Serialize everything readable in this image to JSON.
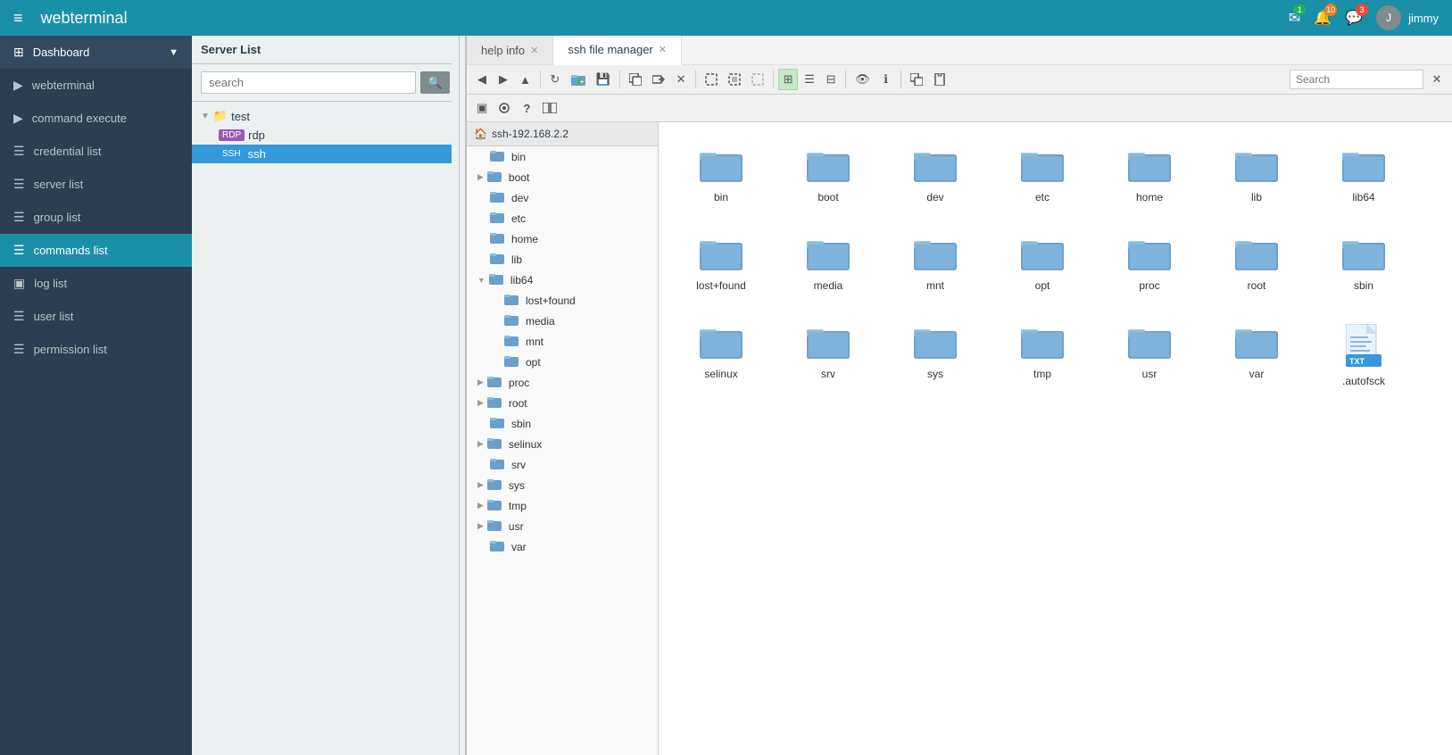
{
  "app": {
    "title_bold": "web",
    "title_light": "terminal"
  },
  "header": {
    "hamburger": "≡",
    "notifications": {
      "mail_count": "1",
      "bell_count": "10",
      "chat_count": "3"
    },
    "username": "jimmy"
  },
  "sidebar": {
    "items": [
      {
        "id": "dashboard",
        "label": "Dashboard",
        "icon": "⊞",
        "has_chevron": true
      },
      {
        "id": "webterminal",
        "label": "webterminal",
        "icon": "▶"
      },
      {
        "id": "command-execute",
        "label": "command execute",
        "icon": "▶"
      },
      {
        "id": "credential-list",
        "label": "credential list",
        "icon": "☰"
      },
      {
        "id": "server-list",
        "label": "server list",
        "icon": "☰"
      },
      {
        "id": "group-list",
        "label": "group list",
        "icon": "☰"
      },
      {
        "id": "commands-list",
        "label": "commands list",
        "icon": "☰"
      },
      {
        "id": "log-list",
        "label": "log list",
        "icon": "▣"
      },
      {
        "id": "user-list",
        "label": "user list",
        "icon": "☰"
      },
      {
        "id": "permission-list",
        "label": "permission list",
        "icon": "☰"
      }
    ]
  },
  "server_panel": {
    "header": "Server List",
    "search_placeholder": "search",
    "search_btn": "🔍",
    "tree": [
      {
        "type": "group",
        "label": "test",
        "indent": 0,
        "expanded": true
      },
      {
        "type": "server",
        "label": "rdp",
        "protocol": "rdp",
        "indent": 1
      },
      {
        "type": "server",
        "label": "ssh",
        "protocol": "ssh",
        "indent": 1,
        "selected": true
      }
    ]
  },
  "tabs": [
    {
      "id": "help-info",
      "label": "help info",
      "closable": true,
      "active": false
    },
    {
      "id": "ssh-file-manager",
      "label": "ssh file manager",
      "closable": true,
      "active": true
    }
  ],
  "toolbar": {
    "buttons_row1": [
      {
        "id": "back",
        "icon": "◀",
        "title": "Back"
      },
      {
        "id": "forward",
        "icon": "▶",
        "title": "Forward"
      },
      {
        "id": "up",
        "icon": "▲",
        "title": "Up"
      },
      {
        "id": "sep1",
        "icon": "",
        "type": "sep"
      },
      {
        "id": "reload",
        "icon": "↻",
        "title": "Reload"
      },
      {
        "id": "new-folder",
        "icon": "📁",
        "title": "New Folder"
      },
      {
        "id": "save",
        "icon": "💾",
        "title": "Save"
      },
      {
        "id": "sep2",
        "icon": "",
        "type": "sep"
      },
      {
        "id": "copy-to",
        "icon": "⬚",
        "title": "Copy To"
      },
      {
        "id": "move-to",
        "icon": "⬚",
        "title": "Move To"
      },
      {
        "id": "delete",
        "icon": "✕",
        "title": "Delete"
      },
      {
        "id": "sep3",
        "icon": "",
        "type": "sep"
      },
      {
        "id": "select-all",
        "icon": "⬚",
        "title": "Select All"
      },
      {
        "id": "invert",
        "icon": "⬚",
        "title": "Invert"
      },
      {
        "id": "select-none",
        "icon": "⬚",
        "title": "Select None"
      },
      {
        "id": "sep4",
        "icon": "",
        "type": "sep"
      },
      {
        "id": "icons-view",
        "icon": "⊞",
        "title": "Icons View",
        "active": true
      },
      {
        "id": "details-view",
        "icon": "☰",
        "title": "Details View"
      },
      {
        "id": "compact-view",
        "icon": "⊟",
        "title": "Compact View"
      },
      {
        "id": "sep5",
        "icon": "",
        "type": "sep"
      },
      {
        "id": "preview",
        "icon": "👁",
        "title": "Preview"
      },
      {
        "id": "info",
        "icon": "ℹ",
        "title": "Info"
      },
      {
        "id": "sep6",
        "icon": "",
        "type": "sep"
      },
      {
        "id": "copy",
        "icon": "⬚",
        "title": "Copy"
      },
      {
        "id": "paste",
        "icon": "⬚",
        "title": "Paste"
      }
    ],
    "search_placeholder": "Search",
    "close_icon": "✕",
    "buttons_row2": [
      {
        "id": "terminal",
        "icon": "▣",
        "title": "Terminal"
      },
      {
        "id": "view",
        "icon": "⊟",
        "title": "View"
      },
      {
        "id": "help",
        "icon": "?",
        "title": "Help"
      },
      {
        "id": "dual-pane",
        "icon": "⊞",
        "title": "Dual Pane"
      }
    ]
  },
  "file_tree": {
    "root": "ssh-192.168.2.2",
    "items": [
      {
        "label": "bin",
        "indent": 0,
        "has_children": false
      },
      {
        "label": "boot",
        "indent": 0,
        "has_children": true
      },
      {
        "label": "dev",
        "indent": 0,
        "has_children": false
      },
      {
        "label": "etc",
        "indent": 0,
        "has_children": false
      },
      {
        "label": "home",
        "indent": 0,
        "has_children": false
      },
      {
        "label": "lib",
        "indent": 0,
        "has_children": false
      },
      {
        "label": "lib64",
        "indent": 0,
        "has_children": true,
        "expanded": true
      },
      {
        "label": "lost+found",
        "indent": 1,
        "has_children": false
      },
      {
        "label": "media",
        "indent": 1,
        "has_children": false
      },
      {
        "label": "mnt",
        "indent": 1,
        "has_children": false
      },
      {
        "label": "opt",
        "indent": 1,
        "has_children": false
      },
      {
        "label": "proc",
        "indent": 0,
        "has_children": true
      },
      {
        "label": "root",
        "indent": 0,
        "has_children": true
      },
      {
        "label": "sbin",
        "indent": 0,
        "has_children": false
      },
      {
        "label": "selinux",
        "indent": 0,
        "has_children": true
      },
      {
        "label": "srv",
        "indent": 0,
        "has_children": false
      },
      {
        "label": "sys",
        "indent": 0,
        "has_children": true
      },
      {
        "label": "tmp",
        "indent": 0,
        "has_children": true
      },
      {
        "label": "usr",
        "indent": 0,
        "has_children": true
      },
      {
        "label": "var",
        "indent": 0,
        "has_children": false
      }
    ]
  },
  "file_grid": {
    "folders": [
      "bin",
      "boot",
      "dev",
      "etc",
      "home",
      "lib",
      "lib64",
      "lost+found",
      "media",
      "mnt",
      "opt",
      "proc",
      "root",
      "sbin",
      "selinux",
      "srv",
      "sys",
      "tmp",
      "usr",
      "var"
    ],
    "files": [
      {
        "name": ".autofsck",
        "type": "txt"
      }
    ]
  }
}
